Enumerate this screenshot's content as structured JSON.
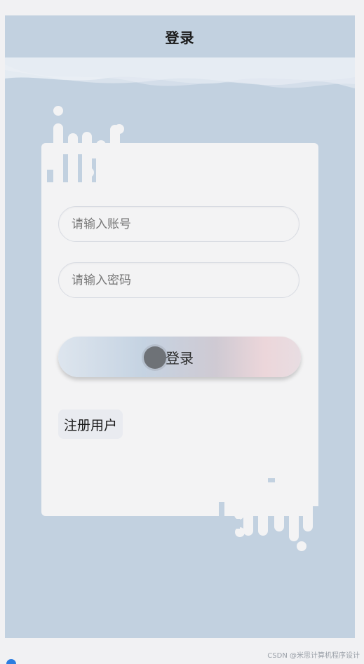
{
  "header": {
    "title": "登录"
  },
  "form": {
    "account_placeholder": "请输入账号",
    "password_placeholder": "请输入密码",
    "login_label": "登录",
    "register_label": "注册用户"
  },
  "footer": {
    "watermark": "CSDN @米思计算机程序设计"
  },
  "colors": {
    "background": "#c2d1e0",
    "card": "#f3f3f4",
    "button_gradient_start": "#dde5ee",
    "button_gradient_end": "#ecd6da"
  }
}
